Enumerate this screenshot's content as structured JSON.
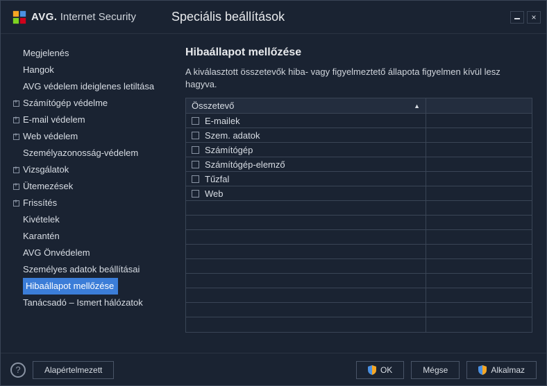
{
  "brand": {
    "bold": "AVG.",
    "light": "Internet Security"
  },
  "window_title": "Speciális beállítások",
  "sidebar": {
    "items": [
      {
        "label": "Megjelenés",
        "expandable": false
      },
      {
        "label": "Hangok",
        "expandable": false
      },
      {
        "label": "AVG védelem ideiglenes letiltása",
        "expandable": false
      },
      {
        "label": "Számítógép védelme",
        "expandable": true
      },
      {
        "label": "E-mail védelem",
        "expandable": true
      },
      {
        "label": "Web védelem",
        "expandable": true
      },
      {
        "label": "Személyazonosság-védelem",
        "expandable": false
      },
      {
        "label": "Vizsgálatok",
        "expandable": true
      },
      {
        "label": "Ütemezések",
        "expandable": true
      },
      {
        "label": "Frissítés",
        "expandable": true
      },
      {
        "label": "Kivételek",
        "expandable": false
      },
      {
        "label": "Karantén",
        "expandable": false
      },
      {
        "label": "AVG Önvédelem",
        "expandable": false
      },
      {
        "label": "Személyes adatok beállításai",
        "expandable": false
      },
      {
        "label": "Hibaállapot mellőzése",
        "expandable": false,
        "selected": true
      },
      {
        "label": "Tanácsadó – Ismert hálózatok",
        "expandable": false
      }
    ]
  },
  "panel": {
    "title": "Hibaállapot mellőzése",
    "description": "A kiválasztott összetevők hiba- vagy figyelmeztető állapota figyelmen kívül lesz hagyva.",
    "header": "Összetevő",
    "rows": [
      {
        "label": "E-mailek"
      },
      {
        "label": "Szem. adatok"
      },
      {
        "label": "Számítógép"
      },
      {
        "label": "Számítógép-elemző"
      },
      {
        "label": "Tűzfal"
      },
      {
        "label": "Web"
      }
    ],
    "empty_rows": 9
  },
  "footer": {
    "default": "Alapértelmezett",
    "ok": "OK",
    "cancel": "Mégse",
    "apply": "Alkalmaz"
  }
}
